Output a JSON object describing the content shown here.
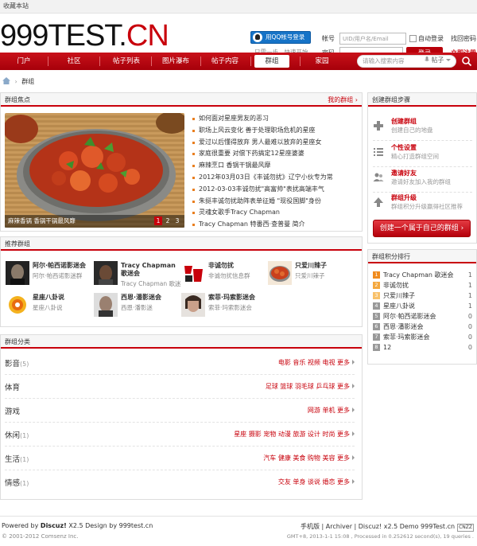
{
  "topbar": {
    "bookmark": "收藏本站"
  },
  "logo": {
    "part1": "999TEST.",
    "part2": "CN"
  },
  "qq_login": {
    "button": "用QQ帐号登录",
    "hint": "只需一步，快速开始"
  },
  "login": {
    "account_label": "帐号",
    "account_placeholder": "UID/用户名/Email",
    "remember_label": "自动登录",
    "forgot_label": "找回密码",
    "password_label": "密码",
    "login_button": "登录",
    "register_link": "立即注册"
  },
  "nav": {
    "items": [
      "门户",
      "社区",
      "帖子列表",
      "图片瀑布",
      "帖子内容",
      "群组",
      "家园"
    ],
    "active_index": 5
  },
  "search": {
    "placeholder": "请输入搜索内容",
    "scope": "帖子"
  },
  "breadcrumb": {
    "current": "群组"
  },
  "focus": {
    "title": "群组焦点",
    "more": "我的群组 ›",
    "image_caption": "麻辣香锅 香锅干锅最风靡",
    "pages": [
      "1",
      "2",
      "3"
    ],
    "posts": [
      "如何面对星座男友的恶习",
      "职场上风云变化 善于处理职场危机的星座",
      "爱过以后懂得放弃 男人最难以放弃的星座女",
      "家庭很重要 对偿下药搞定12星座婆婆",
      "麻辣烹口 香锅干锅最风靡",
      "2012年03月03日《丰诚勿扰》辽宁小伙专为常",
      "2012-03-03丰诚勿扰\"高富帅\"表扰高端丰气",
      "朱挺丰诚勿扰助阵表单征婚 \"现役国脚\"身份",
      "灵魂女歌手Tracy Chapman",
      "Tracy Chapman 特番西·查普曼 简介"
    ]
  },
  "recommend": {
    "title": "推荐群组",
    "groups": [
      {
        "name": "阿尔·帕西诺影迷会",
        "sub": "阿尔·帕西诺影迷群"
      },
      {
        "name": "Tracy Chapman 歌迷会",
        "sub": "Tracy Chapman 歌迷"
      },
      {
        "name": "非诚勿扰",
        "sub": "非诚勿扰信息群"
      },
      {
        "name": "只爱川辣子",
        "sub": "只爱川辣子"
      },
      {
        "name": "星座八卦说",
        "sub": "星座八卦说"
      },
      {
        "name": "西恩·潘影迷会",
        "sub": "西恩·潘影迷"
      },
      {
        "name": "索菲·玛索影迷会",
        "sub": "索菲·玛索影迷会"
      }
    ]
  },
  "categories": {
    "title": "群组分类",
    "rows": [
      {
        "name": "影音",
        "count": "(5)",
        "tags": "电影 音乐 视频 电视 更多"
      },
      {
        "name": "体育",
        "count": "",
        "tags": "足球 篮球 羽毛球 乒乓球 更多"
      },
      {
        "name": "游戏",
        "count": "",
        "tags": "网游 单机 更多"
      },
      {
        "name": "休闲",
        "count": "(1)",
        "tags": "星座 摄影 宠物 动漫 旅游 设计 时尚 更多"
      },
      {
        "name": "生活",
        "count": "(1)",
        "tags": "汽车 健康 美食 购物 美容 更多"
      },
      {
        "name": "情感",
        "count": "(1)",
        "tags": "交友 单身 谈说 婚恋 更多"
      }
    ]
  },
  "steps": {
    "title": "创建群组步骤",
    "items": [
      {
        "title": "创建群组",
        "desc": "创建自己的地盘"
      },
      {
        "title": "个性设置",
        "desc": "精心打造群组空间"
      },
      {
        "title": "邀请好友",
        "desc": "邀请好友加入我的群组"
      },
      {
        "title": "群组升级",
        "desc": "群组积分升级赢得社区推荐"
      }
    ],
    "create_button": "创建一个属于自己的群组 ›"
  },
  "ranking": {
    "title": "群组积分排行",
    "rows": [
      {
        "rank": "1",
        "name": "Tracy Chapman 歌迷会",
        "score": "1"
      },
      {
        "rank": "2",
        "name": "非诚勿扰",
        "score": "1"
      },
      {
        "rank": "3",
        "name": "只爱川辣子",
        "score": "1"
      },
      {
        "rank": "4",
        "name": "星座八卦说",
        "score": "1"
      },
      {
        "rank": "5",
        "name": "阿尔·帕西诺影迷会",
        "score": "0"
      },
      {
        "rank": "6",
        "name": "西恩·潘影迷会",
        "score": "0"
      },
      {
        "rank": "7",
        "name": "索菲·玛索影迷会",
        "score": "0"
      },
      {
        "rank": "8",
        "name": "12",
        "score": "0"
      }
    ]
  },
  "footer": {
    "powered_prefix": "Powered by ",
    "powered_brand": "Discuz!",
    "powered_suffix": " X2.5 Design by 999test.cn",
    "copyright": "© 2001-2012 Comsenz Inc.",
    "links": "手机版 | Archiver | Discuz! x2.5 Demo 999Test.cn",
    "cnzz": "CNZZ",
    "stats": "GMT+8, 2013-1-1 15:08 , Processed in 0.252612 second(s), 19 queries ."
  },
  "colors": {
    "brand_red": "#c8000b",
    "accent_orange": "#e97f20"
  }
}
